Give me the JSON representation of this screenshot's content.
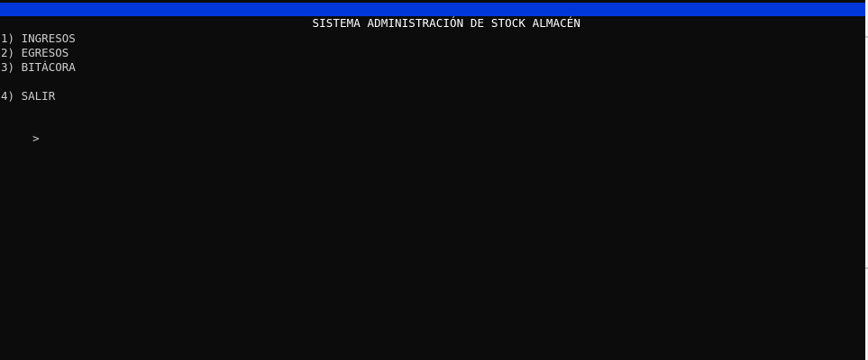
{
  "window": {
    "title_bar_text": "SISTEMA ADMINISTRACIÓN DE STOCK ALMACÉN",
    "title_bar_color": "#0037da",
    "background_color": "#0c0c0c"
  },
  "menu": {
    "items": [
      {
        "number": "1)",
        "label": "INGRESOS"
      },
      {
        "number": "2)",
        "label": "EGRESOS"
      },
      {
        "number": "3)",
        "label": "BITÁCORA"
      },
      {
        "number": "4)",
        "label": "SALIR"
      }
    ]
  },
  "prompt": {
    "symbol": ">"
  }
}
